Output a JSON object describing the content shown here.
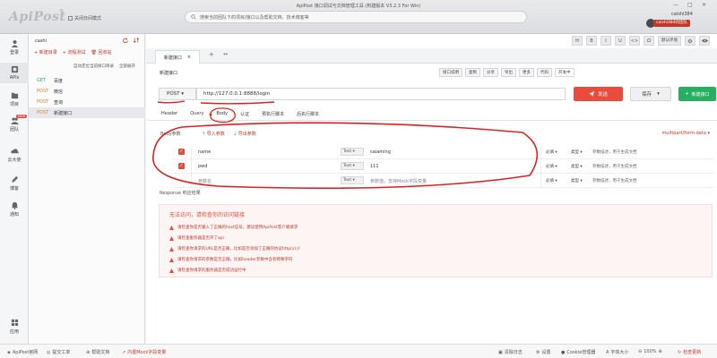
{
  "titlebar": {
    "logo": "ApiPost",
    "logo_reg": "®",
    "mode_label": "关闭日间模式",
    "app_title": "ApiPost 接口调试与文档管理工具 (构建版本 V3.2.3 For Win)",
    "search_placeholder": "搜索当前团队下的项目/接口以及帮助文档、技术博客等",
    "user_name": "caishl384",
    "team_name": "caishl384的团队",
    "win_controls": [
      "—",
      "□",
      "✕"
    ]
  },
  "rail": {
    "items": [
      {
        "label": "登录",
        "icon": "user-icon"
      },
      {
        "label": "APIs",
        "icon": "api-icon",
        "active": true
      },
      {
        "label": "项目",
        "icon": "folder-icon"
      },
      {
        "label": "团队",
        "icon": "team-icon",
        "badge": "NEW"
      },
      {
        "label": "云大使",
        "icon": "cloud-icon"
      },
      {
        "label": "博客",
        "icon": "blog-icon"
      },
      {
        "label": "通知",
        "icon": "bell-icon"
      },
      {
        "label": "应用",
        "icon": "grid-icon"
      }
    ]
  },
  "tree": {
    "project": "cashi",
    "new_api": "+ 新建目录",
    "batch_test": "+ 流程测试",
    "recycle": "回收站",
    "collapse": "自动定位当前接口目录",
    "expand_all": "全部展开",
    "items": [
      {
        "method": "GET",
        "name": "百度"
      },
      {
        "method": "POST",
        "name": "微信"
      },
      {
        "method": "POST",
        "name": "查询"
      },
      {
        "method": "POST",
        "name": "新建接口",
        "selected": true
      }
    ]
  },
  "tabs": {
    "active_tab": "新建接口",
    "close": "×",
    "plus": "+",
    "more": "↔",
    "toolbar": [
      "H",
      "B",
      "I",
      "U",
      "<>",
      "Ω"
    ],
    "env_label": "默认环境",
    "dev_label": "开发中"
  },
  "request": {
    "title": "新建接口",
    "actions": [
      "接口说明",
      "复制",
      "分享",
      "导出",
      "更多",
      "代码"
    ],
    "method": "POST",
    "url": "http://127.0.0.1:8888/login",
    "send": "发送",
    "save": "保存",
    "example": "新建接口",
    "subtabs": [
      "Header",
      "Query",
      "Body",
      "认证",
      "预执行脚本",
      "后执行脚本"
    ],
    "active_subtab": "Body",
    "body_head": "Body参数",
    "import": "导入参数",
    "export": "导出参数",
    "content_type": "multipart/form-data"
  },
  "params": [
    {
      "checked": true,
      "key": "name",
      "type": "Text",
      "value": "caiaming",
      "required": "必填",
      "ptype": "类型",
      "desc": "参数描述，用于生成文档"
    },
    {
      "checked": true,
      "key": "pwd",
      "type": "Text",
      "value": "111",
      "required": "必填",
      "ptype": "类型",
      "desc": "参数描述，用于生成文档"
    },
    {
      "checked": false,
      "key": "参数名",
      "type": "Text",
      "value": "参数值，支持Mock字段变量",
      "required": "必填",
      "ptype": "类型",
      "desc": "参数描述，用于生成文档"
    }
  ],
  "response": {
    "head": "Response 响应结果",
    "title": "无法访问，请检查你的访问链接",
    "lines": [
      "请检查你是否输入了正确的host证号，建议使用ApiPost客户端请求",
      "请检查服务器是否开了api",
      "请检查你请求的URL是否正确，比如是否添加了正确的协议http(s)://",
      "请检查你请求的参数是否正确，比如header参数中含有特殊字符",
      "请检查你请求的服务器是否成功运行中"
    ]
  },
  "statusbar": {
    "left": [
      "ApiPost官网",
      "提交工单",
      "帮助文档"
    ],
    "mock": "内置Mock字段变量",
    "right": [
      "清除日志",
      "设置",
      "Cookie管理器",
      "字体大小",
      "100%",
      "检查更新"
    ]
  },
  "colors": {
    "accent": "#e74c3c",
    "success": "#27ae60",
    "warning": "#e67e22"
  }
}
